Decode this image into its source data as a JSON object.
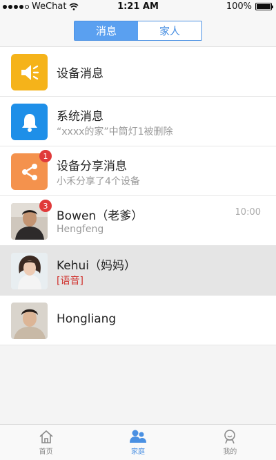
{
  "status_bar": {
    "carrier": "WeChat",
    "time": "1:21 AM",
    "battery": "100%"
  },
  "segmented": {
    "tabs": [
      {
        "label": "消息"
      },
      {
        "label": "家人"
      }
    ]
  },
  "messages": [
    {
      "title": "设备消息",
      "icon": "speaker-icon",
      "color": "#f5b31a"
    },
    {
      "title": "系统消息",
      "subtitle": "“xxxx的家”中筒灯1被删除",
      "icon": "bell-icon",
      "color": "#1e8fe8"
    },
    {
      "title": "设备分享消息",
      "subtitle": "小禾分享了4个设备",
      "badge": "1",
      "icon": "share-icon",
      "color": "#f4924d"
    },
    {
      "title": "Bowen（老爹）",
      "subtitle": "Hengfeng",
      "time": "10:00",
      "badge": "3",
      "icon": "avatar-bowen"
    },
    {
      "title": "Kehui（妈妈）",
      "subtitle": "[语音]",
      "icon": "avatar-kehui"
    },
    {
      "title": "Hongliang",
      "icon": "avatar-hongliang"
    }
  ],
  "tabbar": {
    "items": [
      {
        "label": "首页",
        "icon": "home-icon"
      },
      {
        "label": "家庭",
        "icon": "family-icon"
      },
      {
        "label": "我的",
        "icon": "profile-icon"
      }
    ]
  },
  "colors": {
    "accent": "#4a90e2",
    "badge": "#e03a3a",
    "voice": "#d0312d"
  }
}
